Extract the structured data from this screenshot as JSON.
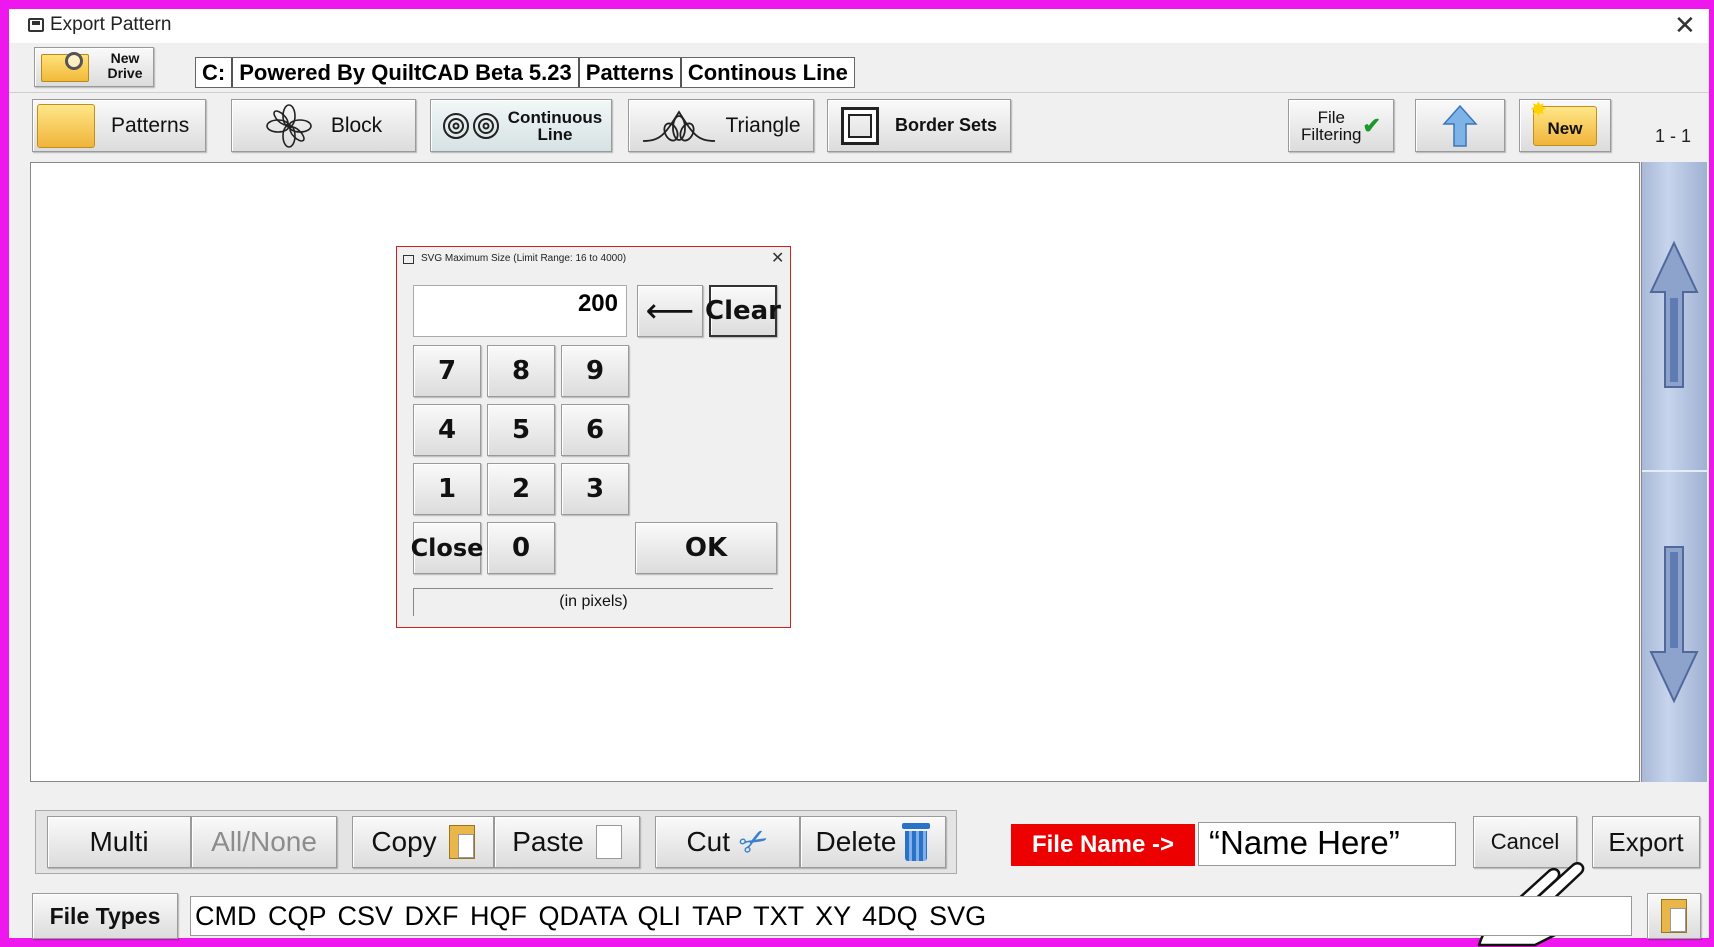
{
  "window": {
    "title": "Export Pattern"
  },
  "header": {
    "new_drive_label": "New Drive",
    "path_segments": [
      "C:",
      "Powered By QuiltCAD Beta 5.23",
      "Patterns",
      "Continous Line"
    ]
  },
  "toolbar": {
    "patterns": "Patterns",
    "block": "Block",
    "continuous_line_top": "Continuous",
    "continuous_line_bottom": "Line",
    "triangle": "Triangle",
    "border_sets": "Border Sets",
    "file_filtering_top": "File",
    "file_filtering_bottom": "Filtering",
    "new": "New",
    "page_indicator": "1 - 1"
  },
  "dialog": {
    "title": "SVG Maximum Size   (Limit Range: 16 to 4000)",
    "value": "200",
    "clear": "Clear",
    "keys": [
      "7",
      "8",
      "9",
      "4",
      "5",
      "6",
      "1",
      "2",
      "3"
    ],
    "close": "Close",
    "zero": "0",
    "ok": "OK",
    "note": "(in pixels)"
  },
  "bottom": {
    "multi": "Multi",
    "all_none": "All/None",
    "copy": "Copy",
    "paste": "Paste",
    "cut": "Cut",
    "delete": "Delete",
    "file_name_label": "File Name ->",
    "file_name_value": "“Name Here”",
    "cancel": "Cancel",
    "export": "Export",
    "file_types_label": "File Types",
    "file_types_list": "CMD CQP CSV DXF HQF QDATA QLI TAP TXT XY 4DQ SVG"
  },
  "colors": {
    "window_border": "#ee18ee",
    "file_name_label_bg": "#ec0000",
    "scrollbar": "#b4c4e2"
  }
}
